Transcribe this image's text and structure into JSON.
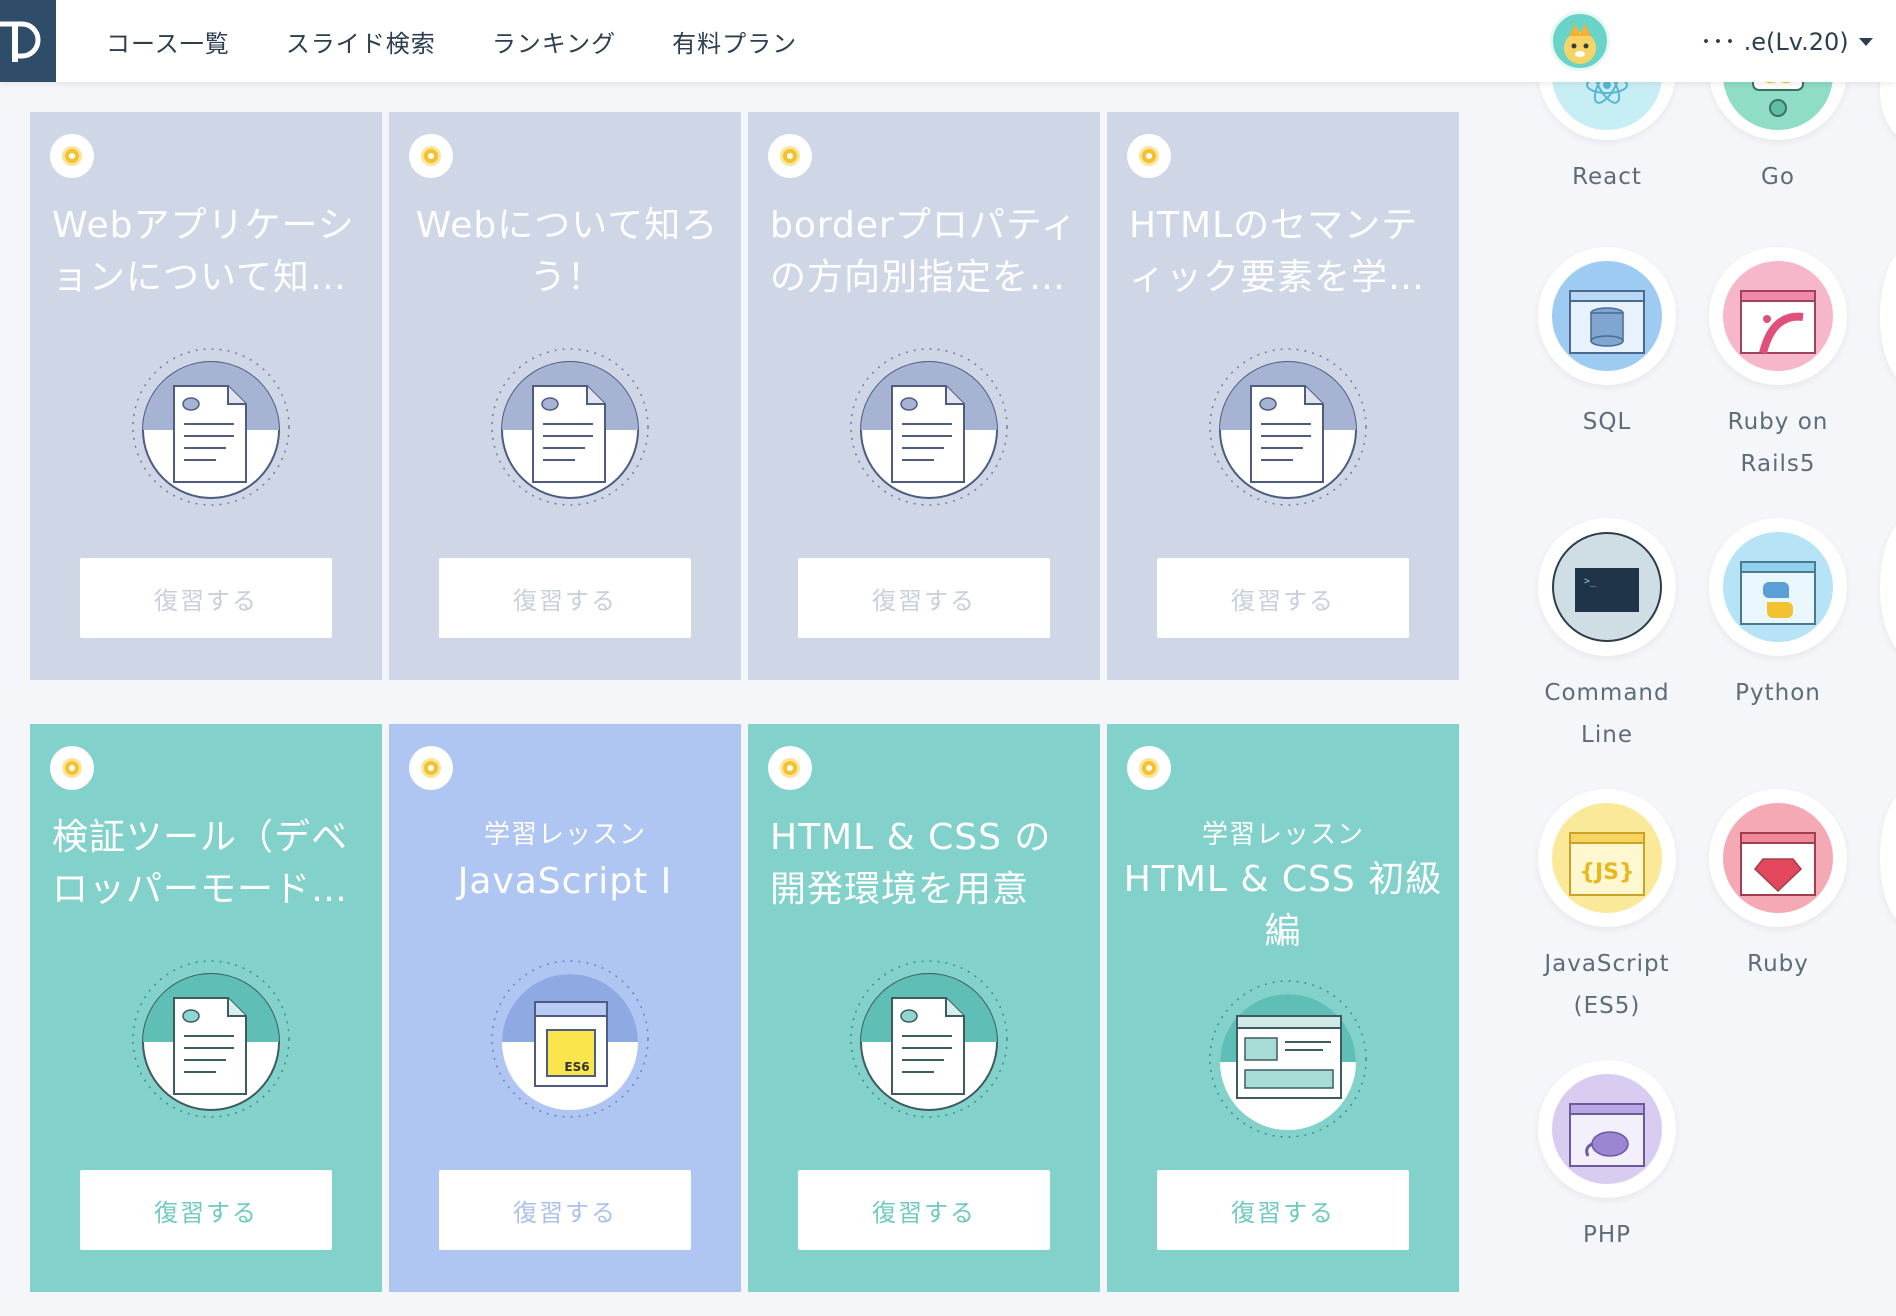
{
  "header": {
    "nav": [
      "コース一覧",
      "スライド検索",
      "ランキング",
      "有料プラン"
    ],
    "user_name": "･･･ .e(Lv.20)"
  },
  "cards": [
    {
      "title": "Webアプリケーションについて知…",
      "button": "復習する",
      "state": "completed"
    },
    {
      "title": "Webについて知ろう！",
      "button": "復習する",
      "state": "completed"
    },
    {
      "title": "borderプロパティの方向別指定を…",
      "button": "復習する",
      "state": "completed"
    },
    {
      "title": "HTMLのセマンティック要素を学…",
      "button": "復習する",
      "state": "completed"
    },
    {
      "title": "検証ツール（デベロッパーモード…",
      "button": "復習する",
      "state": "teal"
    },
    {
      "subtitle": "学習レッスン",
      "title": "JavaScript I",
      "button": "復習する",
      "state": "blue"
    },
    {
      "title": "HTML & CSS の開発環境を用意し…",
      "button": "復習する",
      "state": "teal"
    },
    {
      "subtitle": "学習レッスン",
      "title": "HTML & CSS 初級編",
      "button": "復習する",
      "state": "teal"
    }
  ],
  "skills": [
    {
      "label": "React",
      "icon": "react-icon"
    },
    {
      "label": "Go",
      "icon": "go-icon"
    },
    {
      "label": "SQL",
      "icon": "database-icon"
    },
    {
      "label": "Ruby on Rails5",
      "icon": "rails-icon"
    },
    {
      "label": "Command Line",
      "icon": "terminal-icon"
    },
    {
      "label": "Python",
      "icon": "python-icon"
    },
    {
      "label": "JavaScript (ES5)",
      "icon": "js-icon"
    },
    {
      "label": "Ruby",
      "icon": "ruby-icon"
    },
    {
      "label": "PHP",
      "icon": "php-icon"
    }
  ],
  "colors": {
    "completed": "#cfd6e6",
    "teal": "#83d1cb",
    "blue": "#afc6f2",
    "header_logo": "#2f4d68"
  }
}
